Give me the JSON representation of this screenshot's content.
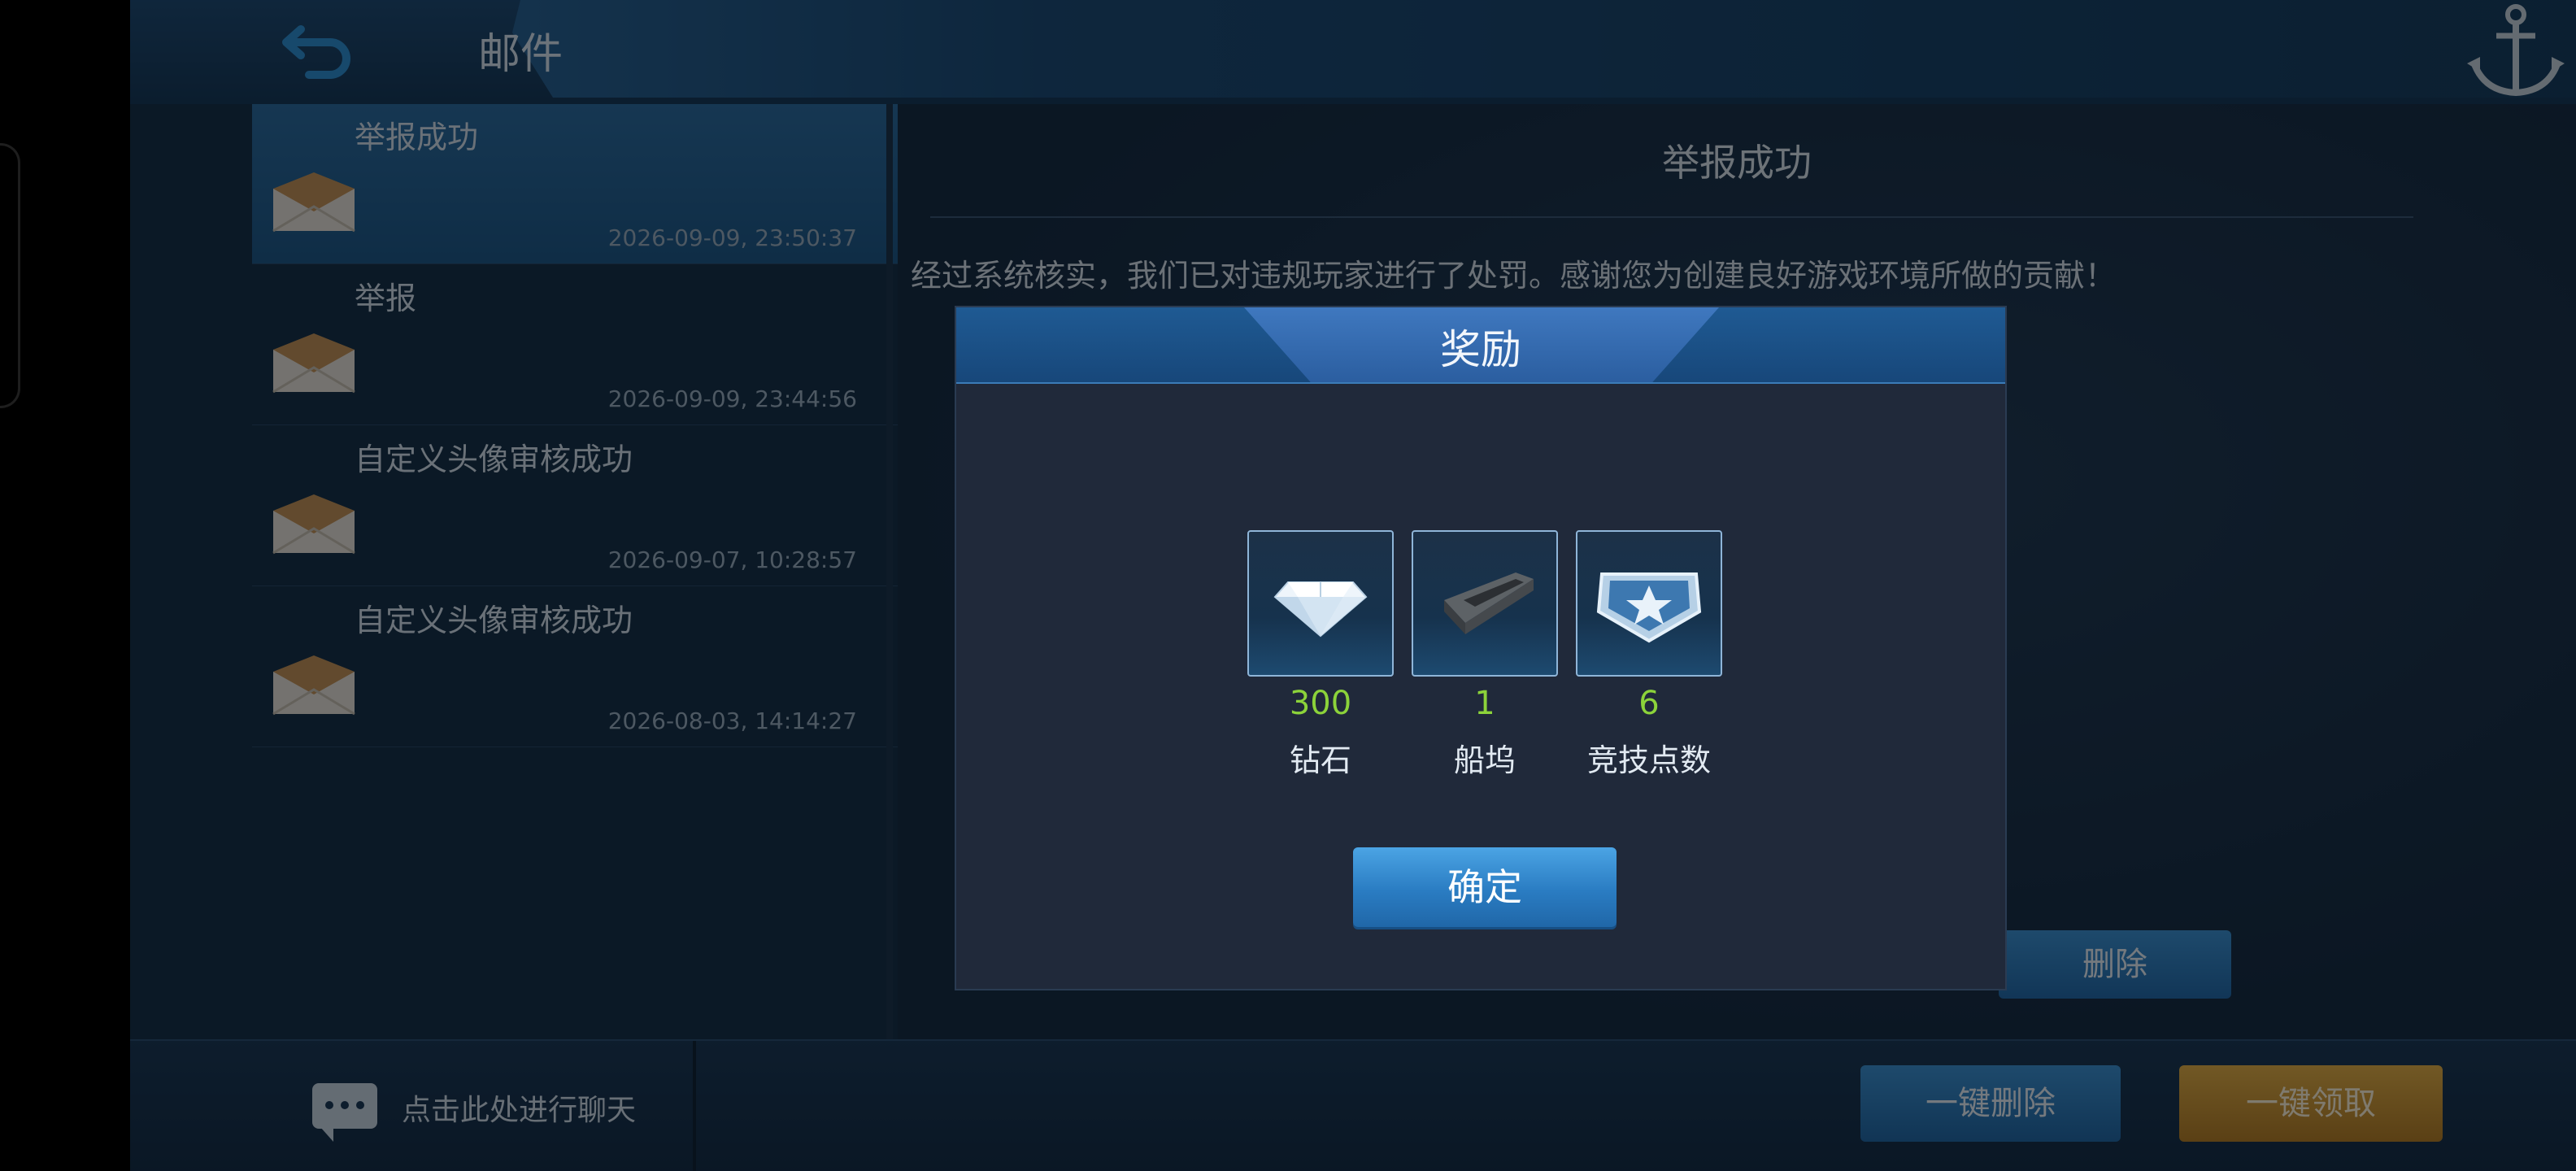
{
  "header": {
    "back_icon": "back-arrow-icon",
    "title": "邮件",
    "logo_icon": "anchor-icon"
  },
  "mail_list": [
    {
      "title": "举报成功",
      "date": "2026-09-09, 23:50:37",
      "selected": true
    },
    {
      "title": "举报",
      "date": "2026-09-09, 23:44:56",
      "selected": false
    },
    {
      "title": "自定义头像审核成功",
      "date": "2026-09-07, 10:28:57",
      "selected": false
    },
    {
      "title": "自定义头像审核成功",
      "date": "2026-08-03, 14:14:27",
      "selected": false
    }
  ],
  "detail": {
    "title": "举报成功",
    "body": "经过系统核实，我们已对违规玩家进行了处罚。感谢您为创建良好游戏环境所做的贡献！",
    "delete_label": "删除"
  },
  "bottom": {
    "chat_text": "点击此处进行聊天",
    "delete_all_label": "一键删除",
    "claim_all_label": "一键领取"
  },
  "modal": {
    "title": "奖励",
    "rewards": [
      {
        "icon": "diamond-icon",
        "count": "300",
        "name": "钻石"
      },
      {
        "icon": "dock-icon",
        "count": "1",
        "name": "船坞"
      },
      {
        "icon": "star-badge-icon",
        "count": "6",
        "name": "竞技点数"
      }
    ],
    "ok_label": "确定"
  },
  "colors": {
    "accent_blue": "#2f92d8",
    "count_green": "#8cd33a",
    "gold": "#e3b14a"
  }
}
